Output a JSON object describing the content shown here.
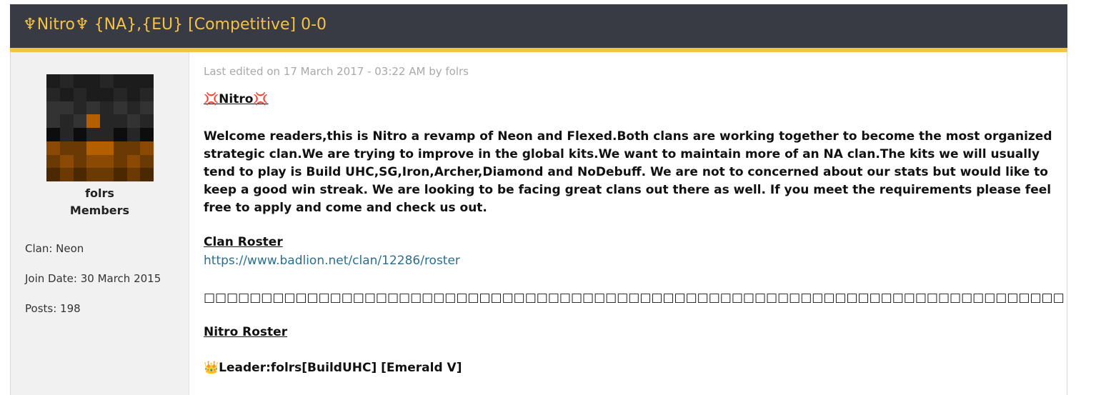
{
  "thread": {
    "title": "♆Nitro♆ {NA},{EU} [Competitive] 0-0"
  },
  "colors": {
    "header_bg": "#383b44",
    "accent": "#f6c244",
    "link": "#2a6f8f",
    "sidebar_bg": "#f1f1f1"
  },
  "user": {
    "avatar_icon": "minecraft-skin-face",
    "username": "folrs",
    "group": "Members",
    "clan": "Clan: Neon",
    "join_date": "Join Date: 30 March 2015",
    "posts": "Posts: 198"
  },
  "post": {
    "edited": "Last edited on 17 March 2017 - 03:22 AM by folrs",
    "heading": "💢Nitro💢",
    "body": "Welcome readers,this is Nitro a revamp of Neon and Flexed.Both clans are working together to become the most organized strategic clan.We are trying to improve in the global kits.We want to maintain more of an NA clan.The kits we will usually tend to play is Build UHC,SG,Iron,Archer,Diamond and NoDebuff. We are not to concerned about our stats but would like to keep a good win streak. We are looking to be facing great clans out there as well. If you meet the requirements please feel free to apply and come and check us out.",
    "clan_roster_heading": "Clan Roster",
    "clan_roster_link": "https://www.badlion.net/clan/12286/roster",
    "separator": "□□□□□□□□□□□□□□□□□□□□□□□□□□□□□□□□□□□□□□□□□□□□□□□□□□□□□□□□□□□□□□□□□□□□□□□□□□□□□□□□□□□□□□□□□□",
    "nitro_roster_heading": "Nitro Roster",
    "leader_line": "👑Leader:folrs[BuildUHC] [Emerald V]"
  }
}
